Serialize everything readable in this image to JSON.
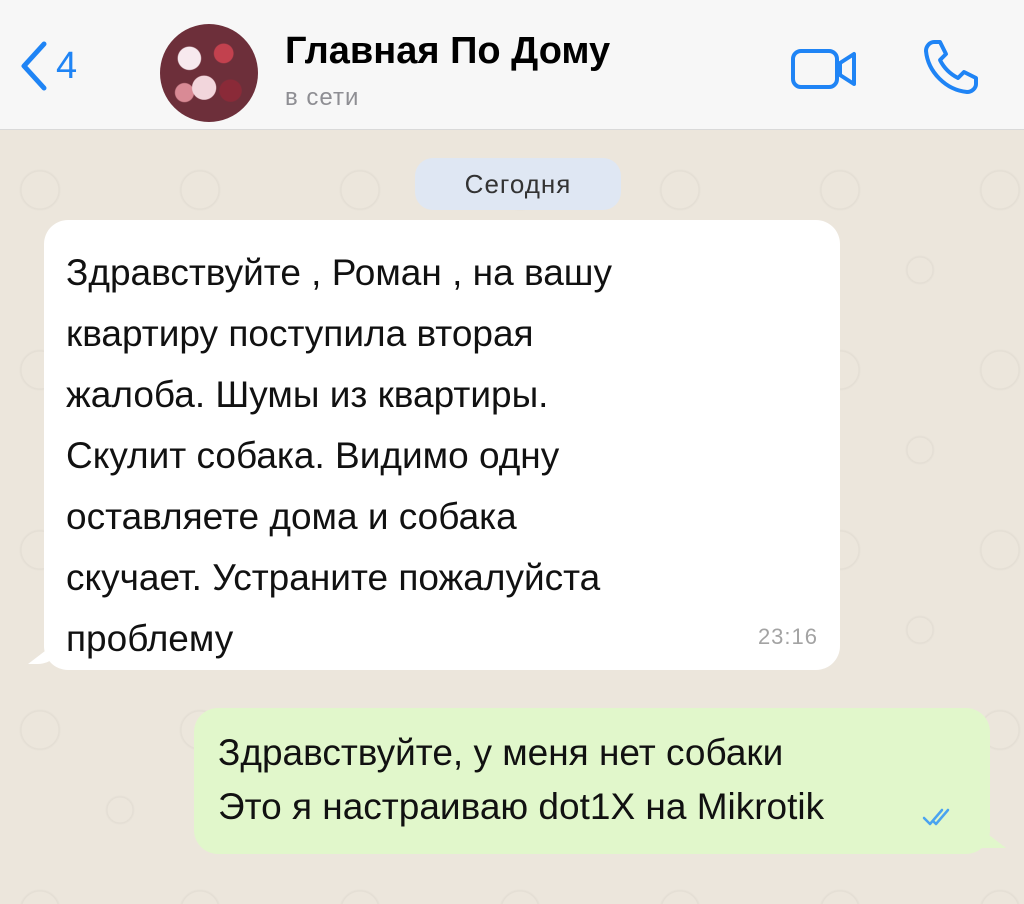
{
  "header": {
    "back_count": "4",
    "title": "Главная По Дому",
    "status": "в сети"
  },
  "chat": {
    "date_label": "Сегодня",
    "messages": [
      {
        "direction": "incoming",
        "text": "Здравствуйте , Роман , на вашу\nквартиру поступила вторая\nжалоба. Шумы из квартиры.\nСкулит собака. Видимо одну\nоставляете дома и собака\nскучает. Устраните пожалуйста\nпроблему",
        "time": "23:16"
      },
      {
        "direction": "outgoing",
        "text": "Здравствуйте, у меня нет собаки\nЭто я настраиваю dot1X на Mikrotik",
        "status": "read-double-check"
      }
    ]
  },
  "colors": {
    "accent": "#1f84f5",
    "incoming_bubble": "#ffffff",
    "outgoing_bubble": "#e1f7cb",
    "chat_background": "#ece6dc",
    "read_ticks": "#4aa3f0"
  },
  "icons": {
    "back": "chevron-left-icon",
    "video": "video-camera-icon",
    "call": "phone-icon",
    "read": "double-check-icon"
  }
}
